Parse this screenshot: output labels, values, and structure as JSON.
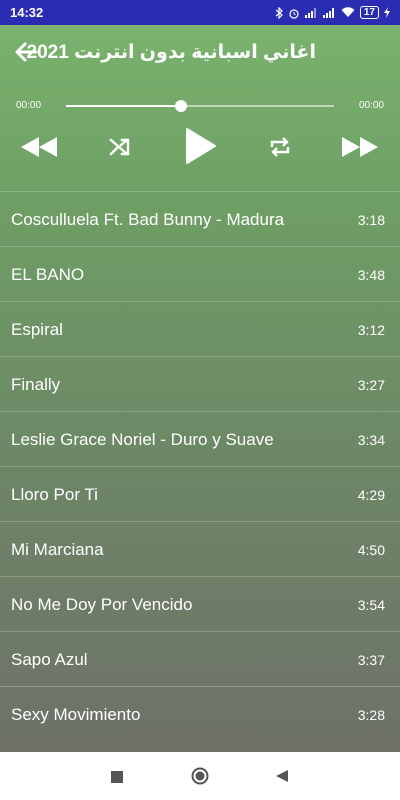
{
  "status_bar": {
    "time": "14:32",
    "battery": "17"
  },
  "header": {
    "title": "اغاني اسبانية بدون انترنت 2021"
  },
  "player": {
    "time_elapsed": "00:00",
    "time_total": "00:00",
    "progress": 0.43
  },
  "tracks": [
    {
      "title": "Cosculluela Ft. Bad Bunny - Madura",
      "duration": "3:18"
    },
    {
      "title": "EL BANO",
      "duration": "3:48"
    },
    {
      "title": "Espiral",
      "duration": "3:12"
    },
    {
      "title": "Finally",
      "duration": "3:27"
    },
    {
      "title": "Leslie Grace Noriel - Duro y Suave",
      "duration": "3:34"
    },
    {
      "title": "Lloro Por Ti",
      "duration": "4:29"
    },
    {
      "title": "Mi Marciana",
      "duration": "4:50"
    },
    {
      "title": "No Me Doy Por Vencido",
      "duration": "3:54"
    },
    {
      "title": "Sapo Azul",
      "duration": "3:37"
    },
    {
      "title": "Sexy Movimiento",
      "duration": "3:28"
    }
  ],
  "icons": {
    "back": "arrow-left-icon",
    "rewind": "rewind-icon",
    "shuffle": "shuffle-icon",
    "play": "play-icon",
    "repeat": "repeat-icon",
    "fast_forward": "fast-forward-icon",
    "nav_recents": "square-icon",
    "nav_home": "circle-icon",
    "nav_back": "triangle-back-icon"
  },
  "colors": {
    "status_bar": "#2a2db2",
    "header_green": "#7cb56f",
    "bottom_gray": "#6e7168"
  }
}
